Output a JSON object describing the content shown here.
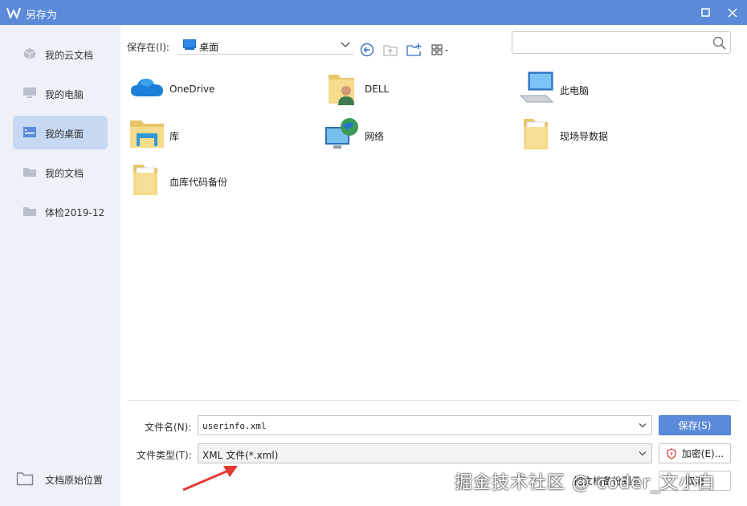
{
  "window": {
    "title": "另存为"
  },
  "sidebar": {
    "items": [
      {
        "label": "我的云文档",
        "icon": "cube-icon"
      },
      {
        "label": "我的电脑",
        "icon": "monitor-icon"
      },
      {
        "label": "我的桌面",
        "icon": "desktop-icon",
        "active": true
      },
      {
        "label": "我的文档",
        "icon": "folder-icon"
      },
      {
        "label": "体检2019-12",
        "icon": "folder-icon"
      }
    ],
    "bottom": {
      "label": "文档原始位置",
      "icon": "folder-outline-icon"
    }
  },
  "toolbar": {
    "save_in_label": "保存在(I):",
    "location": "桌面"
  },
  "search": {
    "placeholder": "",
    "value": ""
  },
  "files": [
    {
      "name": "OneDrive",
      "icon": "onedrive-cloud-icon"
    },
    {
      "name": "DELL",
      "icon": "user-folder-icon"
    },
    {
      "name": "此电脑",
      "icon": "computer-icon"
    },
    {
      "name": "库",
      "icon": "library-icon"
    },
    {
      "name": "网络",
      "icon": "network-icon"
    },
    {
      "name": "现场导数据",
      "icon": "folder-icon"
    },
    {
      "name": "血库代码备份",
      "icon": "folder-icon"
    }
  ],
  "form": {
    "filename_label": "文件名(N):",
    "filename_value": "userinfo.xml",
    "filetype_label": "文件类型(T):",
    "filetype_value": "XML 文件(*.xml)",
    "save_button": "保存(S)",
    "encrypt_button": "加密(E)...",
    "backup_button": "把文档备份到云",
    "cancel_button": "取消"
  },
  "watermark": "掘金技术社区 @ coder_文小白",
  "colors": {
    "accent": "#5b8bd8",
    "sidebar_bg": "#eef2f8",
    "active_item": "#c7d8f2",
    "arrow": "#e53935"
  }
}
